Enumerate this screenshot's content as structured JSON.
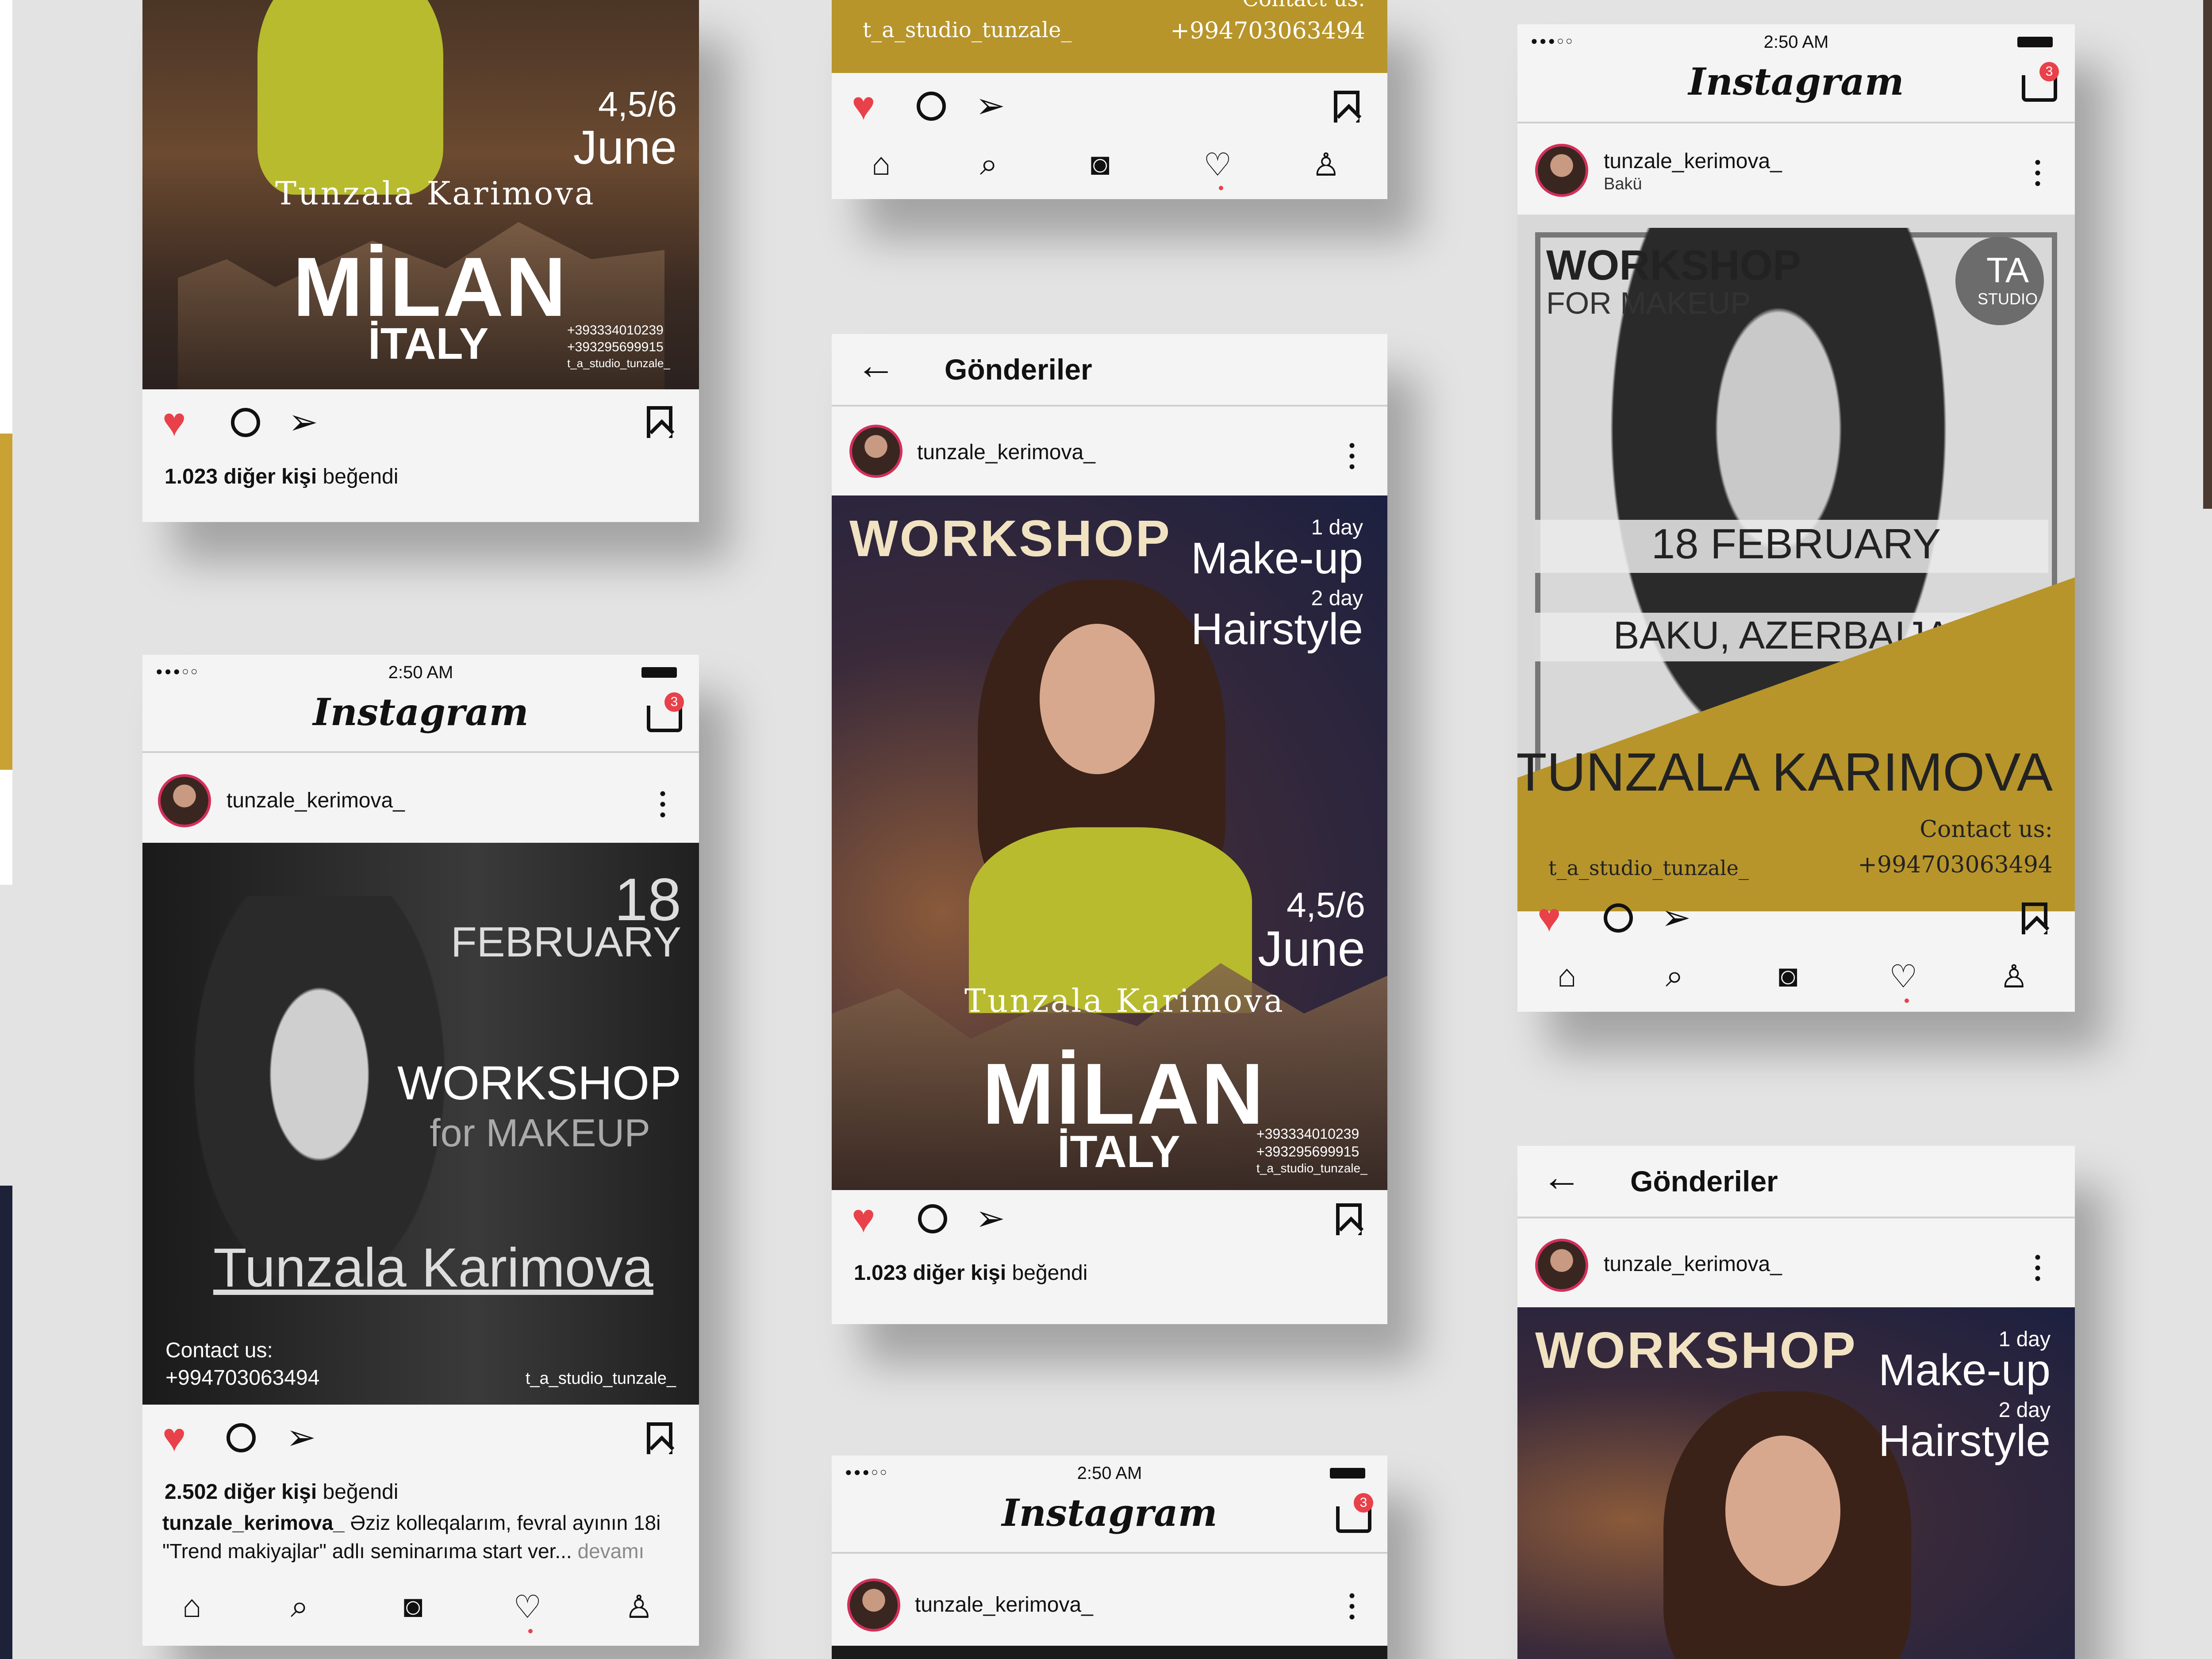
{
  "status": {
    "time": "2:50 AM",
    "dots": "●●●○○"
  },
  "app": {
    "logo": "Instagram",
    "badge": "3",
    "back_title": "Gönderiler"
  },
  "post": {
    "username": "tunzale_kerimova_",
    "location": "Bakü"
  },
  "likes": {
    "a": "1.023 diğer kişi",
    "b": "2.502 diğer kişi",
    "suffix": "beğendi"
  },
  "caption": {
    "user": "tunzale_kerimova_",
    "line1": "Əziz kolleqalarım, fevral ayının 18i",
    "line2": "\"Trend makiyajlar\" adlı seminarıma start ver...",
    "more": "devamı"
  },
  "milan": {
    "workshop": "WORKSHOP",
    "day1": "1 day",
    "makeup": "Make-up",
    "day2": "2 day",
    "hair": "Hairstyle",
    "dates": "4,5/6",
    "month": "June",
    "name": "Tunzala Karimova",
    "city": "MİLAN",
    "country": "İTALY",
    "phone1": "+393334010239",
    "phone2": "+393295699915",
    "handle": "t_a_studio_tunzale_"
  },
  "feb_bw": {
    "day": "18",
    "month": "FEBRUARY",
    "workshop": "WORKSHOP",
    "sub": "for MAKEUP",
    "name": "Tunzala Karimova",
    "contact": "Contact us:",
    "phone": "+994703063494",
    "handle": "t_a_studio_tunzale_"
  },
  "feb_gold": {
    "workshop": "WORKSHOP",
    "sub": "FOR MAKEUP",
    "studio_mark": "TA",
    "studio": "STUDIO",
    "date": "18 FEBRUARY",
    "city": "BAKU, AZERBAIJAN",
    "name": "TUNZALA KARIMOVA",
    "contact": "Contact us:",
    "handle": "t_a_studio_tunzale_",
    "phone": "+994703063494"
  },
  "colors": {
    "heart": "#e8414a",
    "gold": "#b7952b",
    "badge": "#e8414a"
  }
}
